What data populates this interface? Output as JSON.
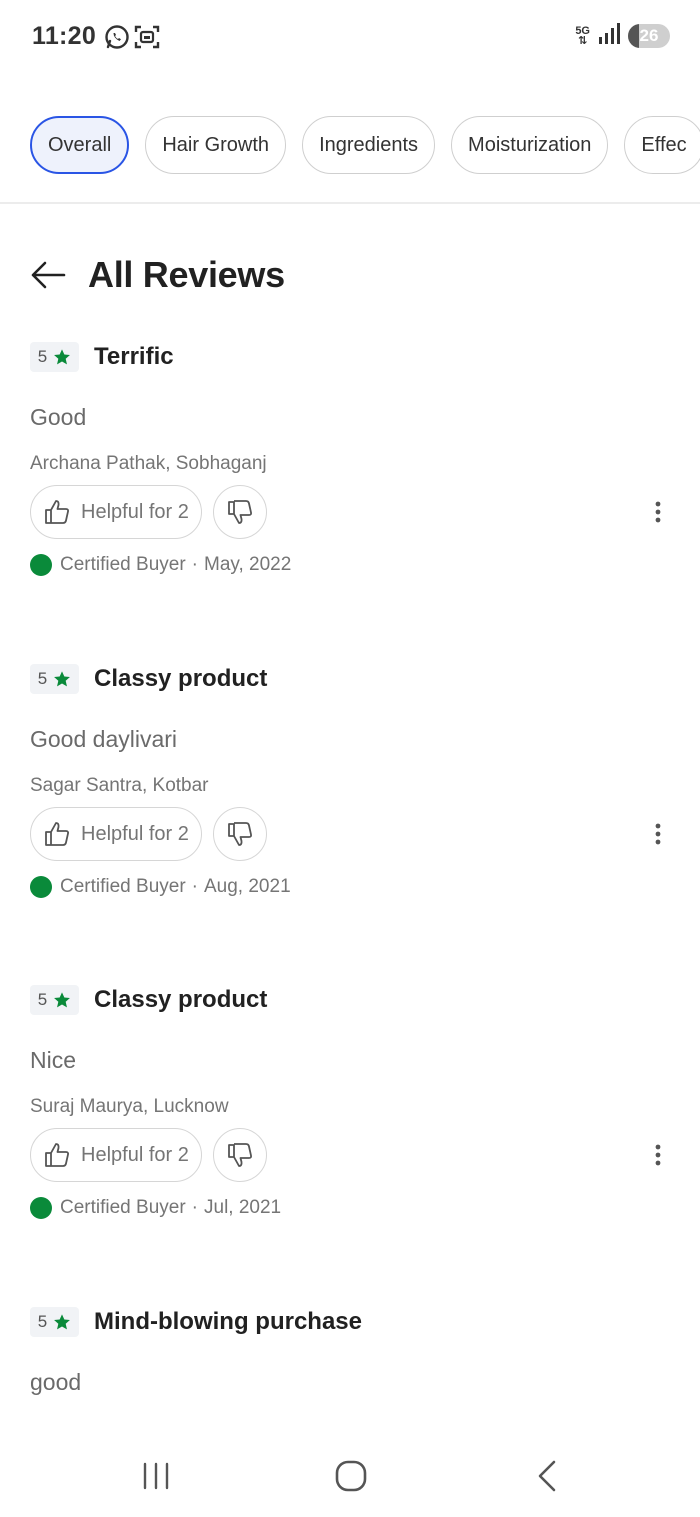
{
  "status_bar": {
    "time": "11:20",
    "notification_icons": [
      "whatsapp-icon",
      "screenshot-icon"
    ],
    "network": "5G",
    "battery_level": "26",
    "battery_fraction": 0.26
  },
  "filter_chips": [
    {
      "label": "Overall",
      "active": true
    },
    {
      "label": "Hair Growth",
      "active": false
    },
    {
      "label": "Ingredients",
      "active": false
    },
    {
      "label": "Moisturization",
      "active": false
    },
    {
      "label": "Effec",
      "active": false
    }
  ],
  "header": {
    "title": "All Reviews",
    "back_icon": "arrow-left-icon"
  },
  "reviews": [
    {
      "rating": "5",
      "title": "Terrific",
      "body": "Good",
      "author": "Archana Pathak, Sobhaganj",
      "helpful": "Helpful for 2",
      "certified": "Certified Buyer",
      "date": "May, 2022"
    },
    {
      "rating": "5",
      "title": "Classy product",
      "body": "Good daylivari",
      "author": "Sagar Santra, Kotbar",
      "helpful": "Helpful for 2",
      "certified": "Certified Buyer",
      "date": "Aug, 2021"
    },
    {
      "rating": "5",
      "title": "Classy product",
      "body": "Nice",
      "author": "Suraj Maurya, Lucknow",
      "helpful": "Helpful for 2",
      "certified": "Certified Buyer",
      "date": "Jul, 2021"
    },
    {
      "rating": "5",
      "title": "Mind-blowing purchase",
      "body": "good"
    }
  ],
  "colors": {
    "accent": "#2a55e5",
    "star": "#0a8a3a",
    "certified": "#0a8a3a"
  },
  "nav_bar": {
    "icons": [
      "recent-apps-icon",
      "home-icon",
      "back-icon"
    ]
  }
}
